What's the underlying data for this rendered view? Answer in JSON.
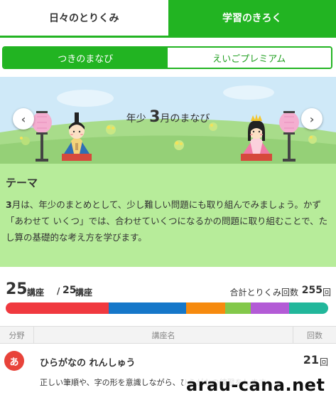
{
  "top_tabs": [
    {
      "label": "日々のとりくみ",
      "active": false
    },
    {
      "label": "学習のきろく",
      "active": true
    }
  ],
  "sub_tabs": [
    {
      "label": "つきのまなび",
      "active": true
    },
    {
      "label": "えいごプレミアム",
      "active": false
    }
  ],
  "banner": {
    "title_prefix": "年少",
    "month_number": "3",
    "title_suffix": "月のまなび",
    "prev_icon": "chevron-left-icon",
    "next_icon": "chevron-right-icon"
  },
  "theme": {
    "heading": "テーマ",
    "body_bold": "3",
    "body": "月は、年少のまとめとして、少し難しい問題にも取り組んでみましょう。かず「あわせて いくつ」では、合わせていくつになるかの問題に取り組むことで、たし算の基礎的な考え方を学びます。"
  },
  "stats": {
    "completed": "25",
    "completed_unit": "講座",
    "separator": "/",
    "total": "25",
    "total_unit": "講座",
    "attempts_label": "合計とりくみ回数",
    "attempts_value": "255",
    "attempts_unit": "回"
  },
  "progress_segments": [
    {
      "color": "#f0393f",
      "fraction": 0.32
    },
    {
      "color": "#1577c9",
      "fraction": 0.24
    },
    {
      "color": "#f68a0e",
      "fraction": 0.12
    },
    {
      "color": "#83c84a",
      "fraction": 0.08
    },
    {
      "color": "#b35bd6",
      "fraction": 0.12
    },
    {
      "color": "#22b79b",
      "fraction": 0.12
    }
  ],
  "table": {
    "col_field": "分野",
    "col_name": "講座名",
    "col_count": "回数"
  },
  "rows": [
    {
      "icon_char": "あ",
      "icon_name": "hiragana-icon",
      "title": "ひらがなの れんしゅう",
      "count": "21",
      "count_unit": "回",
      "description": "正しい筆順や、字の形を意識しながら、ひらがなの練習をします。"
    }
  ],
  "watermark": "arau-cana.net",
  "colors": {
    "accent": "#22b422",
    "theme_bg": "#b7ec9a",
    "icon_red": "#e8433a"
  }
}
